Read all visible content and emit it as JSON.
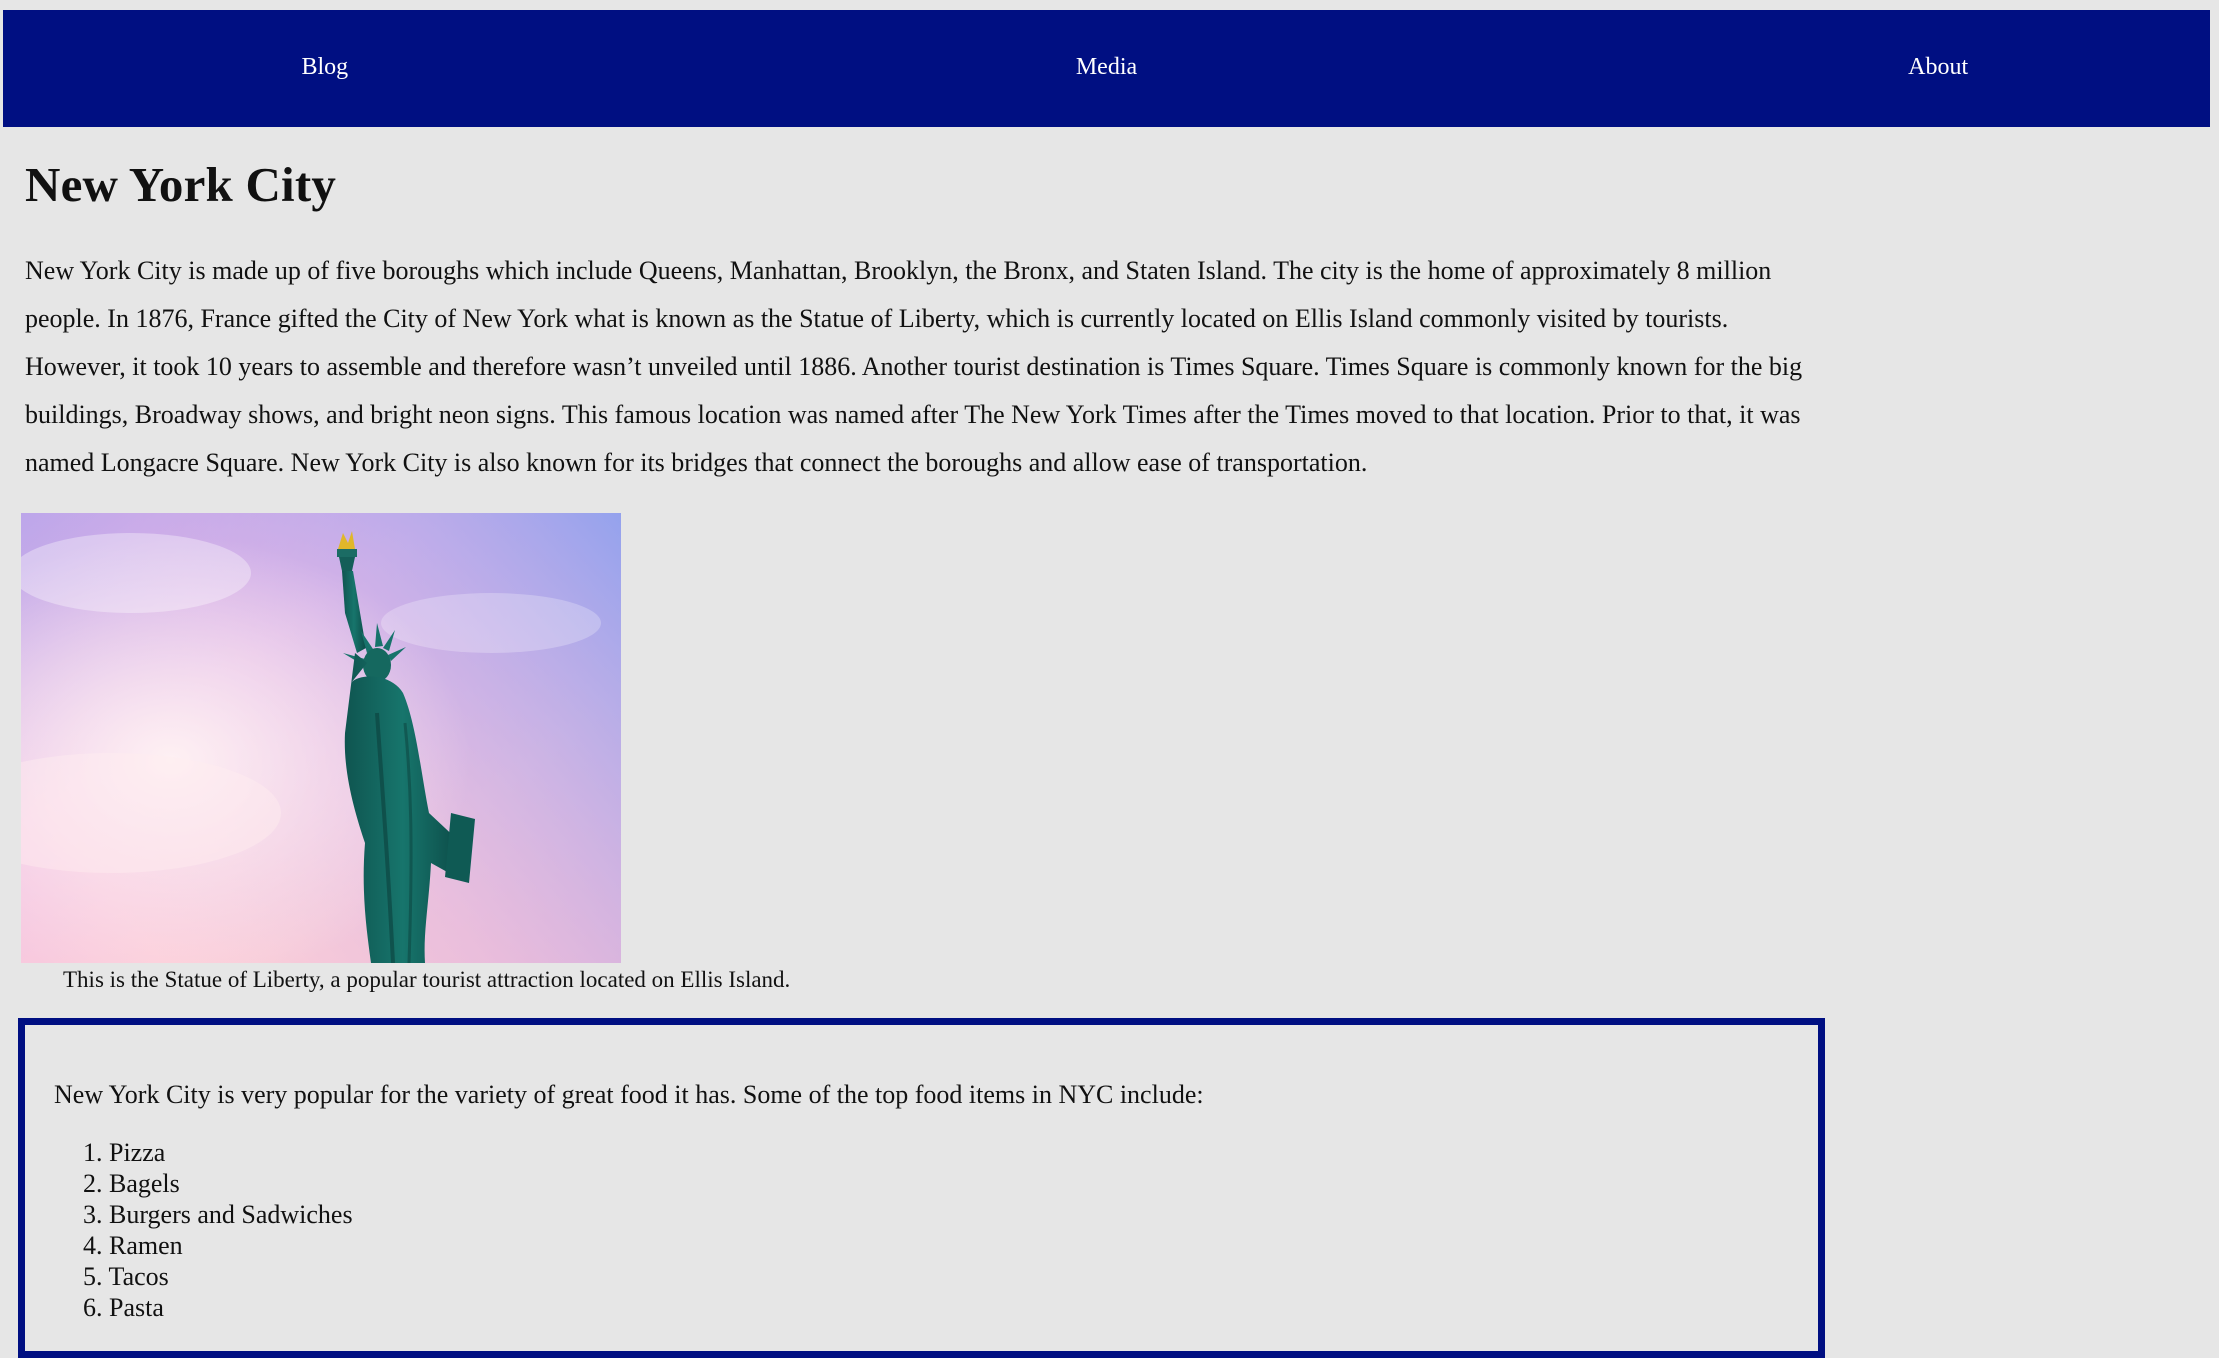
{
  "nav": {
    "items": [
      {
        "label": "Blog"
      },
      {
        "label": "Media"
      },
      {
        "label": "About"
      }
    ],
    "background_color": "#000f82"
  },
  "page_title": "New York City",
  "intro_paragraph": "New York City is made up of five boroughs which include Queens, Manhattan, Brooklyn, the Bronx, and Staten Island. The city is the home of approximately 8 million people. In 1876, France gifted the City of New York what is known as the Statue of Liberty, which is currently located on Ellis Island commonly visited by tourists. However, it took 10 years to assemble and therefore wasn’t unveiled until 1886. Another tourist destination is Times Square. Times Square is commonly known for the big buildings, Broadway shows, and bright neon signs. This famous location was named after The New York Times after the Times moved to that location. Prior to that, it was named Longacre Square. New York City is also known for its bridges that connect the boroughs and allow ease of transportation.",
  "image": {
    "caption": "This is the Statue of Liberty, a popular tourist attraction located on Ellis Island."
  },
  "food_section": {
    "intro": "New York City is very popular for the variety of great food it has. Some of the top food items in NYC include:",
    "items": [
      "1. Pizza",
      "2. Bagels",
      "3. Burgers and Sadwiches",
      "4. Ramen",
      "5. Tacos",
      "6. Pasta"
    ],
    "border_color": "#000f82"
  },
  "colors": {
    "page_background": "#e6e6e6",
    "nav_text": "#ffffff"
  }
}
